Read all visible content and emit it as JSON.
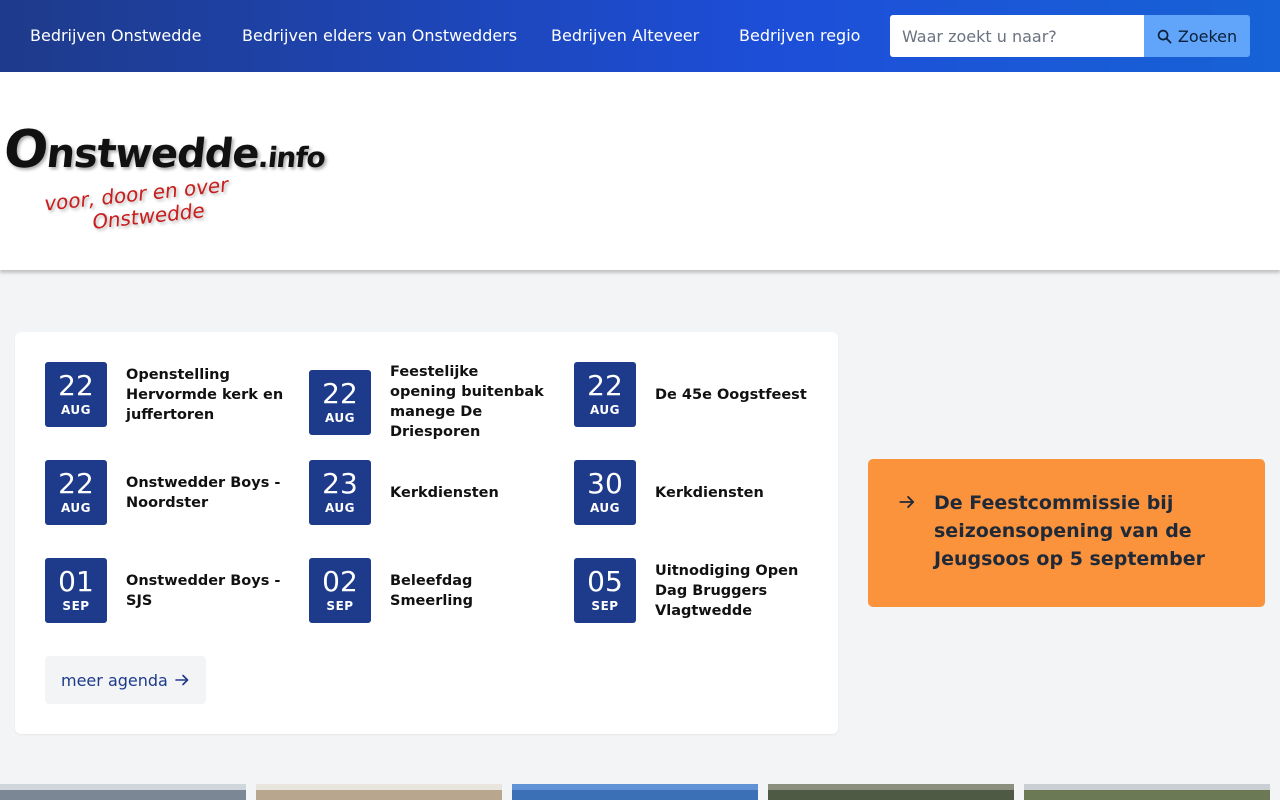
{
  "nav": {
    "links": [
      "Bedrijven Onstwedde",
      "Bedrijven elders van Onstwedders",
      "Bedrijven Alteveer",
      "Bedrijven regio"
    ],
    "search_placeholder": "Waar zoekt u naar?",
    "search_button": "Zoeken",
    "search_icon": "search-icon"
  },
  "logo": {
    "name": "Onstwedde.info",
    "tagline_line1": "voor, door en over",
    "tagline_line2": "Onstwedde"
  },
  "agenda": {
    "events": [
      {
        "day": "22",
        "month": "AUG",
        "title": "Openstelling Hervormde kerk en juffertoren"
      },
      {
        "day": "22",
        "month": "AUG",
        "title": "Feestelijke opening buitenbak manege De Driesporen"
      },
      {
        "day": "22",
        "month": "AUG",
        "title": "De 45e Oogstfeest"
      },
      {
        "day": "22",
        "month": "AUG",
        "title": "Onstwedder Boys - Noordster"
      },
      {
        "day": "23",
        "month": "AUG",
        "title": "Kerkdiensten"
      },
      {
        "day": "30",
        "month": "AUG",
        "title": "Kerkdiensten"
      },
      {
        "day": "01",
        "month": "SEP",
        "title": "Onstwedder Boys - SJS"
      },
      {
        "day": "02",
        "month": "SEP",
        "title": "Beleefdag Smeerling"
      },
      {
        "day": "05",
        "month": "SEP",
        "title": "Uitnodiging Open Dag Bruggers Vlagtwedde"
      }
    ],
    "more_label": "meer agenda"
  },
  "callout": {
    "text": "De Feestcommissie bij seizoensopening van de Jeugsoos op 5 september",
    "color": "#fb923c"
  },
  "colors": {
    "nav_start": "#1e3a8a",
    "nav_end": "#1762d6",
    "datebox": "#1e3a8a",
    "search_button": "#60a5fa",
    "page_bg": "#f3f4f6"
  }
}
